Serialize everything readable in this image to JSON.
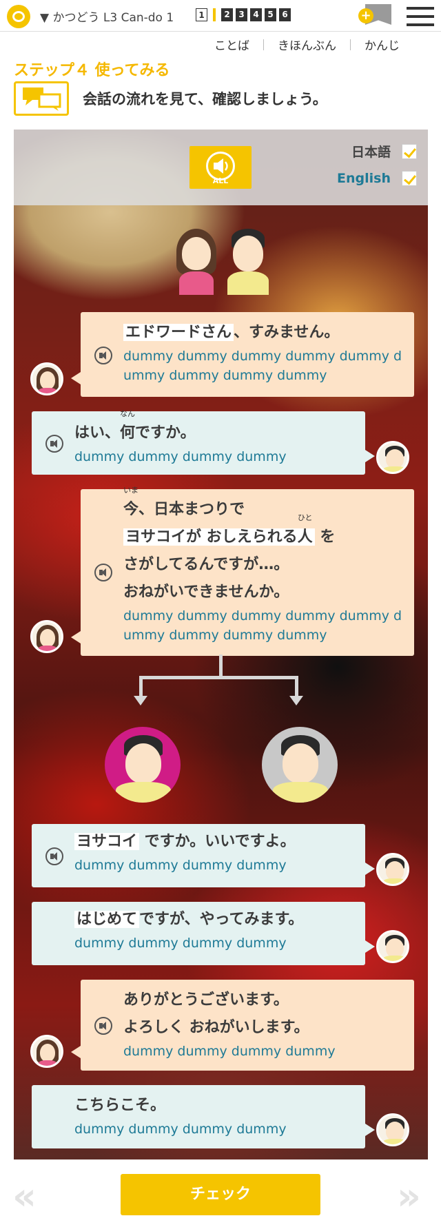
{
  "header": {
    "lesson_title": "▼ かつどう  L3 Can-do 1",
    "steps": [
      "1",
      "2",
      "3",
      "4",
      "5",
      "6"
    ],
    "bookmark_plus": "+"
  },
  "subnav": {
    "items": [
      "ことば",
      "きほんぶん",
      "かんじ"
    ]
  },
  "step": {
    "title": "ステップ４ 使ってみる",
    "instruction": "会話の流れを見て、確認しましょう。"
  },
  "controls": {
    "play_all_label": "ALL",
    "japanese_toggle": "日本語",
    "english_toggle": "English"
  },
  "dialogue": [
    {
      "speaker": "female",
      "jp_highlight": "エドワードさん",
      "jp_rest": "、すみません。",
      "en": "dummy dummy dummy dummy dummy dummy dummy dummy dummy"
    },
    {
      "speaker": "male",
      "jp_a": "はい、",
      "jp_ruby_base": "何",
      "jp_ruby": "なん",
      "jp_b": "ですか。",
      "en": "dummy dummy dummy dummy"
    },
    {
      "speaker": "female",
      "line1_ruby_base": "今",
      "line1_ruby": "いま",
      "line1_rest": "、日本まつりで",
      "line2_highlight": "ヨサコイが おしえられる",
      "line2_ruby_base": "人",
      "line2_ruby": "ひと",
      "line2_rest": " を",
      "line3": "さがしてるんですが…。",
      "line4": "おねがいできませんか。",
      "en": "dummy dummy dummy dummy dummy dummy dummy dummy dummy"
    },
    {
      "speaker": "male",
      "jp_highlight": "ヨサコイ",
      "jp_rest": " ですか。いいですよ。",
      "en": "dummy dummy dummy dummy"
    },
    {
      "speaker": "male",
      "jp_highlight": "はじめて",
      "jp_rest": "ですが、やってみます。",
      "en": "dummy dummy dummy dummy"
    },
    {
      "speaker": "female",
      "line1": "ありがとうございます。",
      "line2": "よろしく おねがいします。",
      "en": "dummy dummy dummy dummy"
    },
    {
      "speaker": "male",
      "jp": "こちらこそ。",
      "en": "dummy dummy dummy dummy"
    }
  ],
  "footer": {
    "prev": "«",
    "check_label": "チェック",
    "next": "»"
  },
  "colors": {
    "accent": "#f5c400",
    "female_bubble": "#fde3c8",
    "male_bubble": "#e4f2f1",
    "english_text": "#1e7a96"
  }
}
